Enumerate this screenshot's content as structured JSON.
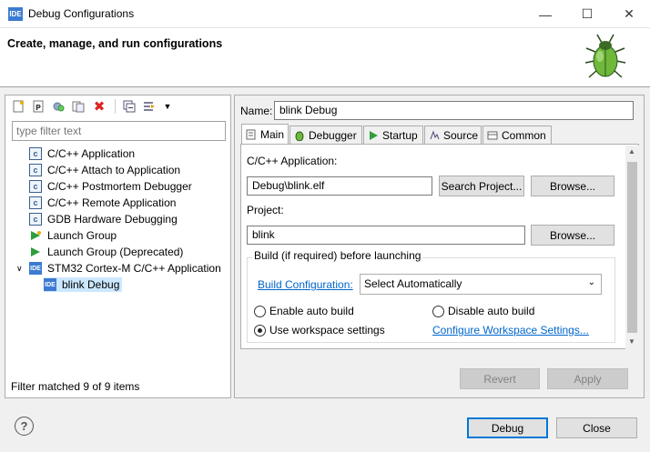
{
  "window": {
    "icon": "IDE",
    "title": "Debug Configurations",
    "controls": [
      "minimize-icon",
      "maximize-icon",
      "close-icon"
    ]
  },
  "banner": {
    "title": "Create, manage, and run configurations",
    "icon": "bug-icon"
  },
  "left": {
    "toolbar": [
      "new-config-icon",
      "new-prototype-icon",
      "duplicate-icon",
      "export-icon",
      "delete-icon",
      "collapse-all-icon",
      "filter-icon",
      "dropdown-icon"
    ],
    "filter_placeholder": "type filter text",
    "tree": [
      {
        "label": "C/C++ Application",
        "icon": "c"
      },
      {
        "label": "C/C++ Attach to Application",
        "icon": "c"
      },
      {
        "label": "C/C++ Postmortem Debugger",
        "icon": "c"
      },
      {
        "label": "C/C++ Remote Application",
        "icon": "c"
      },
      {
        "label": "GDB Hardware Debugging",
        "icon": "c"
      },
      {
        "label": "Launch Group",
        "icon": "launch"
      },
      {
        "label": "Launch Group (Deprecated)",
        "icon": "launch"
      },
      {
        "label": "STM32 Cortex-M C/C++ Application",
        "icon": "IDE"
      },
      {
        "label": "blink Debug",
        "icon": "IDE"
      }
    ],
    "status": "Filter matched 9 of 9 items"
  },
  "right": {
    "name_label": "Name:",
    "name_value": "blink Debug",
    "tabs": [
      "Main",
      "Debugger",
      "Startup",
      "Source",
      "Common"
    ],
    "main": {
      "app_label": "C/C++ Application:",
      "app_value": "Debug\\blink.elf",
      "search_project": "Search Project...",
      "browse1": "Browse...",
      "project_label": "Project:",
      "project_value": "blink",
      "browse2": "Browse...",
      "build_group": "Build (if required) before launching",
      "build_config_link": "Build Configuration:",
      "build_config_value": "Select Automatically",
      "enable_auto": "Enable auto build",
      "disable_auto": "Disable auto build",
      "use_workspace": "Use workspace settings",
      "configure_link": "Configure Workspace Settings..."
    },
    "revert": "Revert",
    "apply": "Apply"
  },
  "footer": {
    "help": "?",
    "debug": "Debug",
    "close": "Close"
  }
}
